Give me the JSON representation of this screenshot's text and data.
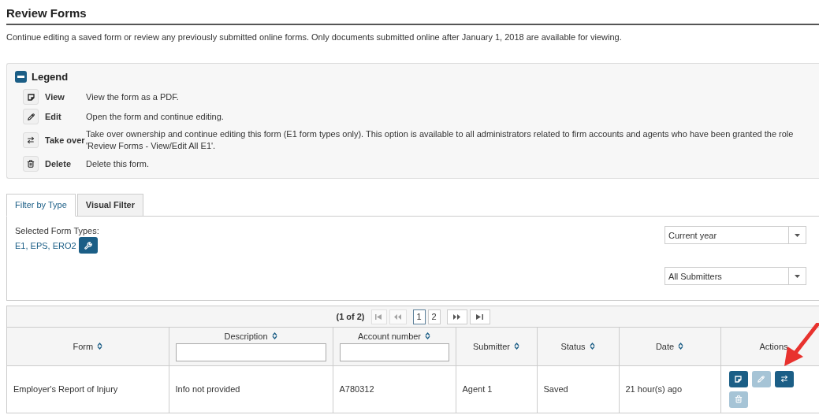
{
  "page_title": "Review Forms",
  "intro": "Continue editing a saved form or review any previously submitted online forms. Only documents submitted online after January 1, 2018 are available for viewing.",
  "legend": {
    "title": "Legend",
    "items": [
      {
        "kind": "view",
        "label": "View",
        "description": "View the form as a PDF."
      },
      {
        "kind": "edit",
        "label": "Edit",
        "description": "Open the form and continue editing."
      },
      {
        "kind": "takeover",
        "label": "Take over",
        "description": "Take over ownership and continue editing this form (E1 form types only). This option is available to all administrators related to firm accounts and agents who have been granted the role 'Review Forms - View/Edit All E1'."
      },
      {
        "kind": "delete",
        "label": "Delete",
        "description": "Delete this form."
      }
    ]
  },
  "tabs": [
    {
      "label": "Filter by Type",
      "selected": true
    },
    {
      "label": "Visual Filter",
      "selected": false
    }
  ],
  "filter": {
    "label": "Selected Form Types:",
    "value": "E1, EPS, ERO2",
    "selects": [
      "Current year",
      "All Submitters"
    ]
  },
  "paginator": {
    "summary": "(1 of 2)",
    "first_disabled": true,
    "prev_disabled": true,
    "pages": [
      {
        "label": "1",
        "selected": true
      },
      {
        "label": "2",
        "selected": false
      }
    ]
  },
  "table": {
    "columns": [
      {
        "label": "Form",
        "sortable": true,
        "filter": false
      },
      {
        "label": "Description",
        "sortable": true,
        "filter": true
      },
      {
        "label": "Account number",
        "sortable": true,
        "filter": true
      },
      {
        "label": "Submitter",
        "sortable": true,
        "filter": false
      },
      {
        "label": "Status",
        "sortable": true,
        "filter": false
      },
      {
        "label": "Date",
        "sortable": true,
        "filter": false
      },
      {
        "label": "Actions",
        "sortable": false,
        "filter": false
      }
    ],
    "rows": [
      {
        "cells": [
          "Employer's Report of Injury",
          "Info not provided",
          "A780312",
          "Agent 1",
          "Saved",
          "21 hour(s) ago"
        ],
        "actions": [
          {
            "kind": "view",
            "disabled": false
          },
          {
            "kind": "edit",
            "disabled": true
          },
          {
            "kind": "takeover",
            "disabled": false
          },
          {
            "kind": "delete",
            "disabled": true
          }
        ]
      }
    ]
  },
  "annotation": {
    "kind": "arrow"
  }
}
